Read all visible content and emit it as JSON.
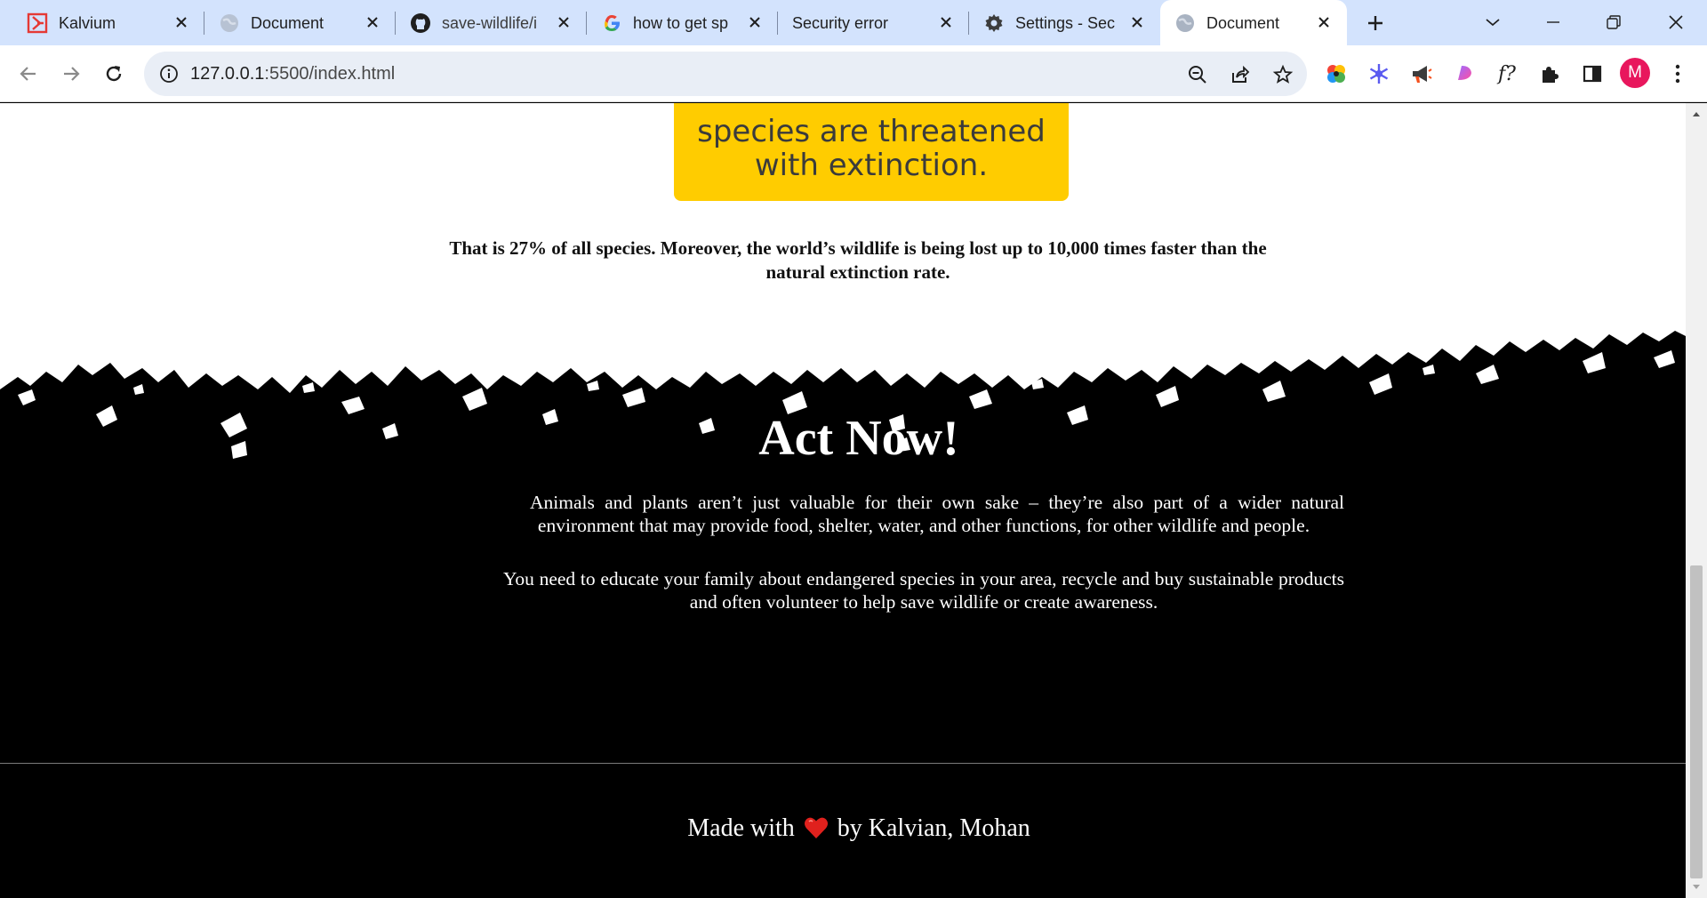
{
  "browser": {
    "tabs": [
      {
        "title": "Kalvium",
        "icon": "kalvium-logo-icon",
        "active": false
      },
      {
        "title": "Document",
        "icon": "globe-icon",
        "active": false
      },
      {
        "title": "save-wildlife/i",
        "icon": "github-icon",
        "active": false
      },
      {
        "title": "how to get sp",
        "icon": "google-icon",
        "active": false
      },
      {
        "title": "Security error",
        "icon": "none",
        "active": false
      },
      {
        "title": "Settings - Sec",
        "icon": "gear-icon",
        "active": false
      },
      {
        "title": "Document",
        "icon": "globe-icon",
        "active": true
      }
    ],
    "url_host": "127.0.0.1",
    "url_path": ":5500/index.html",
    "profile_initial": "M",
    "extension_fx_label": "f?",
    "colors": {
      "tabstrip": "#d3e3fd",
      "omnibox": "#e9eef6",
      "avatar": "#e8175d"
    }
  },
  "page": {
    "card_lines": [
      "species are threatened",
      "with extinction."
    ],
    "fact": "That is 27% of all species. Moreover, the world’s wildlife is being lost up to 10,000 times faster than the natural extinction rate.",
    "act_title": "Act Now!",
    "paragraphs": [
      "Animals and plants aren’t just valuable for their own sake – they’re also part of a wider natural environment that may provide food, shelter, water, and other functions, for other wildlife and people.",
      "You need to educate your family about endangered species in your area, recycle and buy sustainable products and often volunteer to help save wildlife or create awareness."
    ],
    "footer_before": "Made with",
    "footer_after": "by Kalvian, Mohan",
    "colors": {
      "card": "#ffcc00",
      "heart": "#e0211d",
      "background_dark": "#000000"
    }
  }
}
